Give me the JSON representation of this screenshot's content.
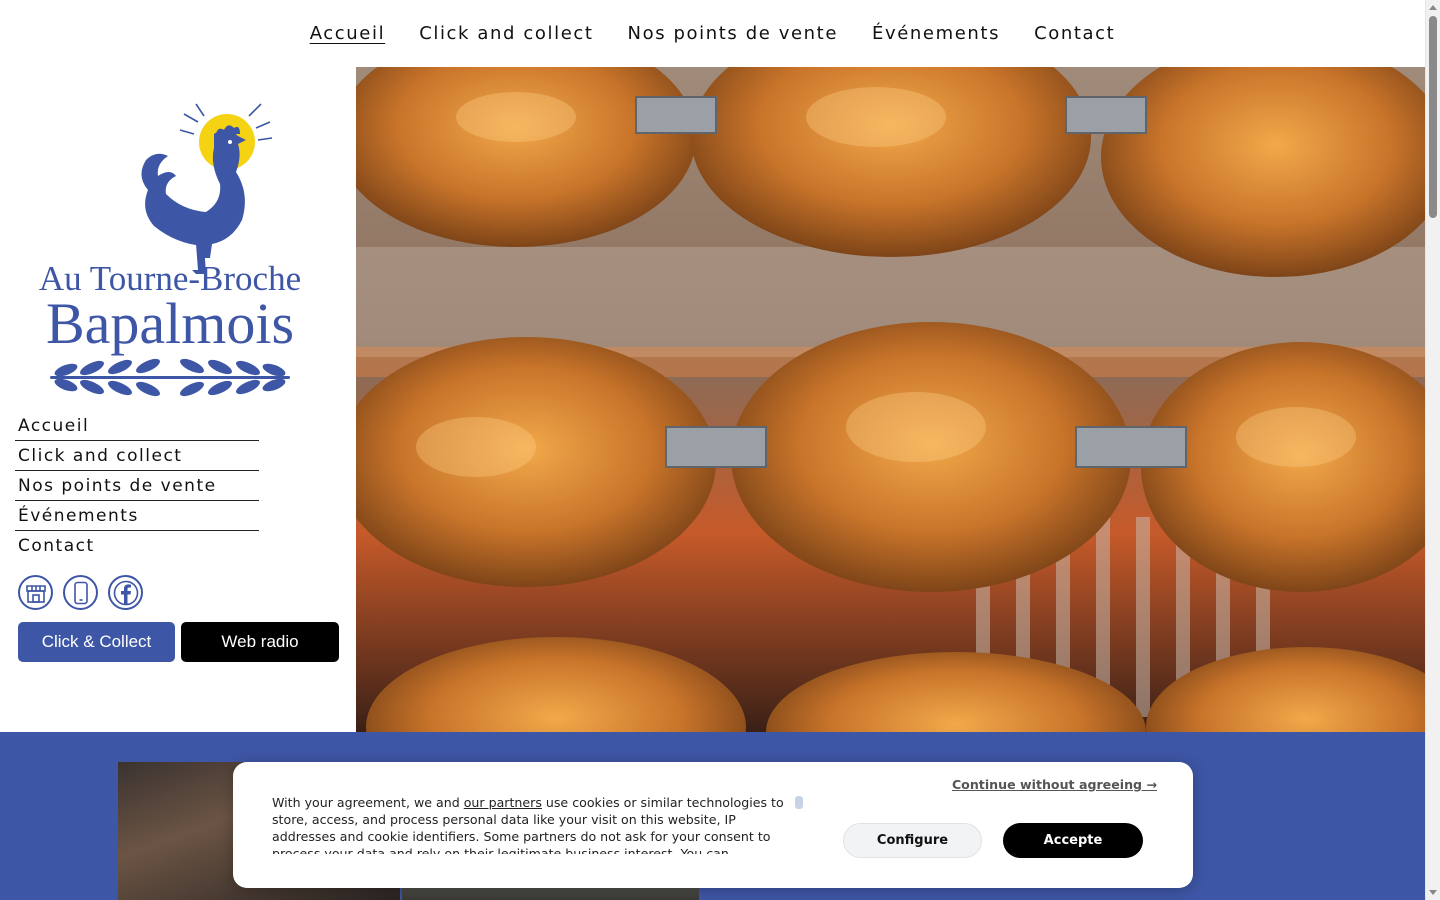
{
  "top_nav": {
    "items": [
      {
        "label": "Accueil",
        "active": true
      },
      {
        "label": "Click and collect",
        "active": false
      },
      {
        "label": "Nos points de vente",
        "active": false
      },
      {
        "label": "Événements",
        "active": false
      },
      {
        "label": "Contact",
        "active": false
      }
    ]
  },
  "logo": {
    "line1": "Au Tourne-Broche",
    "line2": "Bapalmois"
  },
  "side_nav": {
    "items": [
      {
        "label": "Accueil"
      },
      {
        "label": "Click and collect"
      },
      {
        "label": "Nos points de vente"
      },
      {
        "label": "Événements"
      },
      {
        "label": "Contact"
      }
    ]
  },
  "social": {
    "icons": [
      "shop-icon",
      "phone-icon",
      "facebook-icon"
    ]
  },
  "buttons": {
    "click_collect": "Click & Collect",
    "web_radio": "Web radio"
  },
  "cookie": {
    "text_before_link": "With your agreement, we and ",
    "link": "our partners",
    "text_after_link": " use cookies or similar technologies to store, access, and process personal data like your visit on this website, IP addresses and cookie identifiers. Some partners do not ask for your consent to process your data and rely on their legitimate business interest. You can",
    "continue": "Continue without agreeing →",
    "configure": "Configure",
    "accept": "Accepte"
  },
  "colors": {
    "brand_blue": "#3e56a6",
    "sun_yellow": "#f5d312",
    "black": "#000000"
  }
}
